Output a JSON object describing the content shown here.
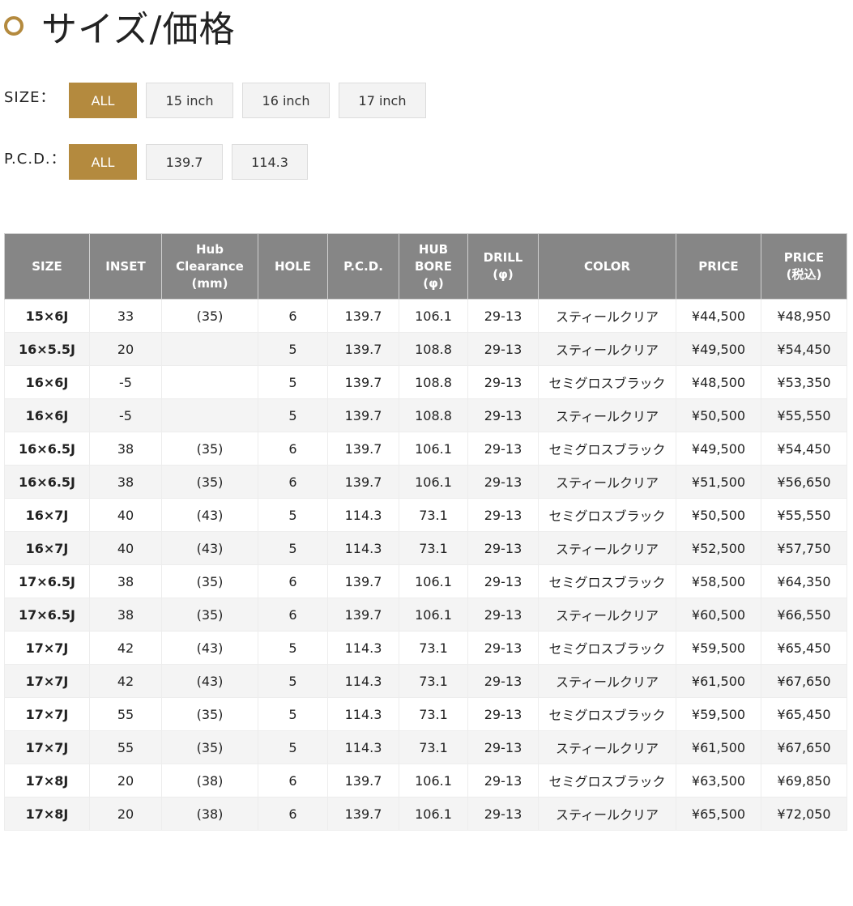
{
  "title": "サイズ/価格",
  "accent_color": "#b48a3e",
  "filters": {
    "size": {
      "label": "SIZE：",
      "options": [
        "ALL",
        "15 inch",
        "16 inch",
        "17 inch"
      ],
      "selected": "ALL"
    },
    "pcd": {
      "label": "P.C.D.：",
      "options": [
        "ALL",
        "139.7",
        "114.3"
      ],
      "selected": "ALL"
    }
  },
  "table": {
    "headers": {
      "size": "SIZE",
      "inset": "INSET",
      "hub_clearance": [
        "Hub",
        "Clearance",
        "(mm)"
      ],
      "hole": "HOLE",
      "pcd": "P.C.D.",
      "hub_bore": [
        "HUB",
        "BORE",
        "(φ)"
      ],
      "drill": [
        "DRILL",
        "(φ)"
      ],
      "color": "COLOR",
      "price": "PRICE",
      "price_tax": [
        "PRICE",
        "(税込)"
      ]
    },
    "rows": [
      [
        "15×6J",
        "33",
        "(35)",
        "6",
        "139.7",
        "106.1",
        "29-13",
        "スティールクリア",
        "¥44,500",
        "¥48,950"
      ],
      [
        "16×5.5J",
        "20",
        "",
        "5",
        "139.7",
        "108.8",
        "29-13",
        "スティールクリア",
        "¥49,500",
        "¥54,450"
      ],
      [
        "16×6J",
        "-5",
        "",
        "5",
        "139.7",
        "108.8",
        "29-13",
        "セミグロスブラック",
        "¥48,500",
        "¥53,350"
      ],
      [
        "16×6J",
        "-5",
        "",
        "5",
        "139.7",
        "108.8",
        "29-13",
        "スティールクリア",
        "¥50,500",
        "¥55,550"
      ],
      [
        "16×6.5J",
        "38",
        "(35)",
        "6",
        "139.7",
        "106.1",
        "29-13",
        "セミグロスブラック",
        "¥49,500",
        "¥54,450"
      ],
      [
        "16×6.5J",
        "38",
        "(35)",
        "6",
        "139.7",
        "106.1",
        "29-13",
        "スティールクリア",
        "¥51,500",
        "¥56,650"
      ],
      [
        "16×7J",
        "40",
        "(43)",
        "5",
        "114.3",
        "73.1",
        "29-13",
        "セミグロスブラック",
        "¥50,500",
        "¥55,550"
      ],
      [
        "16×7J",
        "40",
        "(43)",
        "5",
        "114.3",
        "73.1",
        "29-13",
        "スティールクリア",
        "¥52,500",
        "¥57,750"
      ],
      [
        "17×6.5J",
        "38",
        "(35)",
        "6",
        "139.7",
        "106.1",
        "29-13",
        "セミグロスブラック",
        "¥58,500",
        "¥64,350"
      ],
      [
        "17×6.5J",
        "38",
        "(35)",
        "6",
        "139.7",
        "106.1",
        "29-13",
        "スティールクリア",
        "¥60,500",
        "¥66,550"
      ],
      [
        "17×7J",
        "42",
        "(43)",
        "5",
        "114.3",
        "73.1",
        "29-13",
        "セミグロスブラック",
        "¥59,500",
        "¥65,450"
      ],
      [
        "17×7J",
        "42",
        "(43)",
        "5",
        "114.3",
        "73.1",
        "29-13",
        "スティールクリア",
        "¥61,500",
        "¥67,650"
      ],
      [
        "17×7J",
        "55",
        "(35)",
        "5",
        "114.3",
        "73.1",
        "29-13",
        "セミグロスブラック",
        "¥59,500",
        "¥65,450"
      ],
      [
        "17×7J",
        "55",
        "(35)",
        "5",
        "114.3",
        "73.1",
        "29-13",
        "スティールクリア",
        "¥61,500",
        "¥67,650"
      ],
      [
        "17×8J",
        "20",
        "(38)",
        "6",
        "139.7",
        "106.1",
        "29-13",
        "セミグロスブラック",
        "¥63,500",
        "¥69,850"
      ],
      [
        "17×8J",
        "20",
        "(38)",
        "6",
        "139.7",
        "106.1",
        "29-13",
        "スティールクリア",
        "¥65,500",
        "¥72,050"
      ]
    ]
  }
}
